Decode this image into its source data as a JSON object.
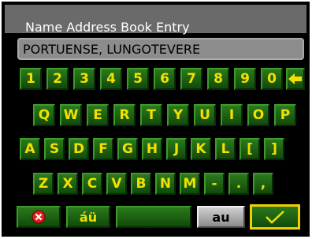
{
  "title": "Name Address Book Entry",
  "entry_value": "PORTUENSE, LUNGOTEVERE",
  "rows": [
    [
      "1",
      "2",
      "3",
      "4",
      "5",
      "6",
      "7",
      "8",
      "9",
      "0"
    ],
    [
      "Q",
      "W",
      "E",
      "R",
      "T",
      "Y",
      "U",
      "I",
      "O",
      "P"
    ],
    [
      "A",
      "S",
      "D",
      "F",
      "G",
      "H",
      "J",
      "K",
      "L",
      "[",
      "]"
    ],
    [
      "Z",
      "X",
      "C",
      "V",
      "B",
      "N",
      "M",
      "-",
      ".",
      ","
    ]
  ],
  "bottom": {
    "accent_label": "áü",
    "case_label": "au"
  },
  "colors": {
    "key_text": "#f2e000",
    "key_green": "#1e6a12",
    "accent_yellow": "#f2d000"
  }
}
